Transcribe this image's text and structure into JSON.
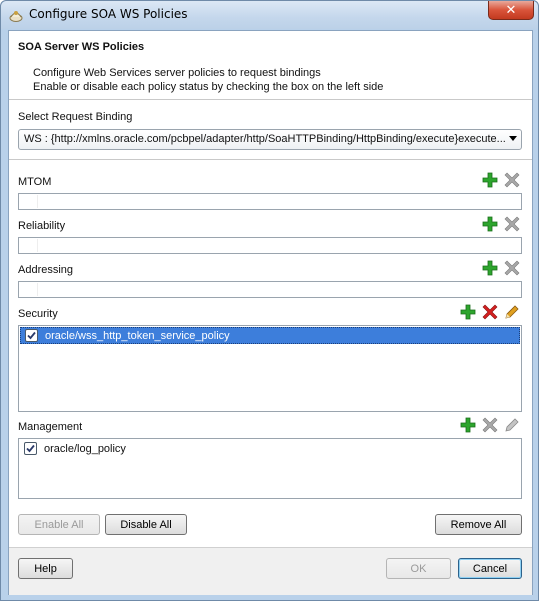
{
  "window": {
    "title": "Configure SOA WS Policies",
    "close_glyph": "✕"
  },
  "header": {
    "title": "SOA Server WS Policies",
    "line1": "Configure Web Services server policies to request bindings",
    "line2": "Enable or disable each policy status by checking the box on the left side"
  },
  "request_binding": {
    "label": "Select Request Binding",
    "selected_value": "WS : {http://xmlns.oracle.com/pcbpel/adapter/http/SoaHTTPBinding/HttpBinding/execute}execute..."
  },
  "sections": {
    "mtom": {
      "label": "MTOM",
      "items": []
    },
    "reliability": {
      "label": "Reliability",
      "items": []
    },
    "addressing": {
      "label": "Addressing",
      "items": []
    },
    "security": {
      "label": "Security",
      "items": [
        {
          "name": "oracle/wss_http_token_service_policy",
          "checked": true,
          "selected": true
        }
      ]
    },
    "management": {
      "label": "Management",
      "items": [
        {
          "name": "oracle/log_policy",
          "checked": true,
          "selected": false
        }
      ]
    }
  },
  "buttons": {
    "enable_all": "Enable All",
    "disable_all": "Disable All",
    "remove_all": "Remove All",
    "help": "Help",
    "ok": "OK",
    "cancel": "Cancel"
  },
  "colors": {
    "add": "#2da52d",
    "remove_active": "#d42020",
    "remove_disabled": "#9a9a9a",
    "edit": "#e0a020",
    "selection": "#3d7edb"
  },
  "icons": {
    "add": "plus-icon",
    "remove": "x-icon",
    "edit": "pencil-icon"
  }
}
